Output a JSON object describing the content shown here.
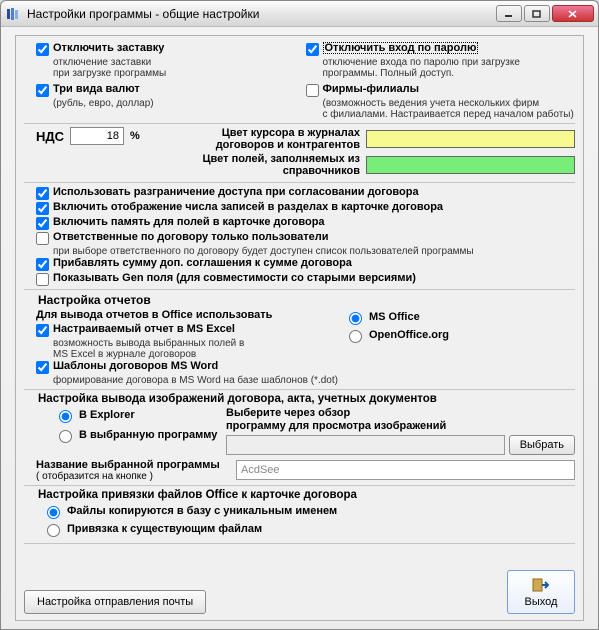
{
  "window": {
    "title": "Настройки программы - общие настройки"
  },
  "top": {
    "disable_splash": {
      "label": "Отключить заставку",
      "sub": "отключение заставки\nпри загрузке программы",
      "checked": true
    },
    "disable_password": {
      "label": "Отключить вход по паролю",
      "sub": "отключение входа по паролю при загрузке\nпрограммы. Полный доступ.",
      "checked": true
    },
    "three_currencies": {
      "label": "Три вида валют",
      "sub": "(рубль, евро, доллар)",
      "checked": true
    },
    "branches": {
      "label": "Фирмы-филиалы",
      "sub": "(возможность ведения учета нескольких фирм\nс филиалами. Настраивается перед началом работы)",
      "checked": false
    }
  },
  "vat": {
    "label": "НДС",
    "value": "18",
    "percent": "%"
  },
  "colors": {
    "cursor_label": "Цвет курсора в журналах договоров и контрагентов",
    "cursor_hex": "#f7fb8f",
    "fields_label": "Цвет полей, заполняемых из справочников",
    "fields_hex": "#77ee77"
  },
  "middle": {
    "access_control": {
      "label": "Использовать разграничение доступа при согласовании договора",
      "checked": true
    },
    "show_counts": {
      "label": "Включить отображение числа записей в разделах в карточке договора",
      "checked": true
    },
    "field_memory": {
      "label": "Включить память для полей в карточке договора",
      "checked": true
    },
    "responsible_users": {
      "label": "Ответственные по договору только пользователи",
      "sub": "при выборе ответственного по договору будет доступен  список пользователей программы",
      "checked": false
    },
    "add_agreement_sum": {
      "label": "Прибавлять сумму доп. соглашения к сумме договора",
      "checked": true
    },
    "show_gen_fields": {
      "label": "Показывать Gen поля (для совместимости со старыми версиями)",
      "checked": false
    }
  },
  "reports": {
    "title": "Настройка отчетов",
    "office_label": "Для вывода отчетов в Office использовать",
    "office_options": {
      "ms": "MS Office",
      "oo": "OpenOffice.org",
      "selected": "ms"
    },
    "excel_custom": {
      "label": "Настраиваемый отчет в MS Excel",
      "sub": "возможность вывода выбранных полей в\nMS Excel в журнале договоров",
      "checked": true
    },
    "word_templates": {
      "label": "Шаблоны договоров MS Word",
      "sub": "формирование договора в MS Word на базе шаблонов (*.dot)",
      "checked": true
    }
  },
  "images": {
    "title": "Настройка вывода изображений договора,  акта, учетных документов",
    "mode": {
      "explorer": "В Explorer",
      "program": "В выбранную программу",
      "selected": "explorer"
    },
    "choose_label": "Выберите через обзор\nпрограмму для просмотра изображений",
    "choose_btn": "Выбрать",
    "program_path": "",
    "chosen_title": "Название выбранной программы",
    "chosen_sub": "( отобразится на кнопке )",
    "chosen_value": "AcdSee"
  },
  "attach": {
    "title": "Настройка привязки файлов Office к карточке договора",
    "copy_unique": "Файлы копируются в базу с уникальным именем",
    "link_existing": "Привязка к существующим файлам",
    "selected": "copy_unique"
  },
  "bottom": {
    "mail_btn": "Настройка отправления почты",
    "exit_btn": "Выход"
  }
}
